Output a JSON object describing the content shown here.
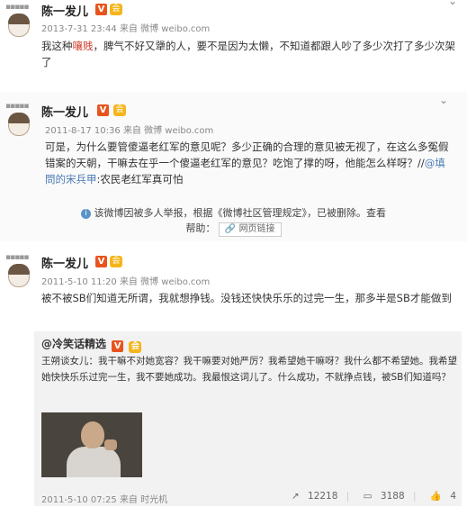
{
  "posts": [
    {
      "author": "陈一发儿",
      "time": "2013-7-31 23:44",
      "via_prefix": "来自",
      "source": "微博 weibo.com",
      "text_before": "我这种",
      "text_highlight": "嚷贱",
      "text_after": "，脾气不好又犟的人，要不是因为太懒，不知道都跟人吵了多少次打了多少次架了"
    },
    {
      "author": "陈一发儿",
      "time": "2011-8-17 10:36",
      "via_prefix": "来自",
      "source": "微博 weibo.com",
      "text_before": "可是，为什么要管傻逼老红军的意见呢？多少正确的合理的意见被无视了，在这么多冤假错案的天朝，干嘛去在乎一个傻逼老红军的意见？吃饱了撑的呀，他能怎么样呀？//",
      "mention": "@填問的宋兵甲",
      "text_after": ":农民老红军真可怕",
      "notice_line1": "该微博因被多人举报，根据《微博社区管理规定》，已被删除。查看",
      "notice_help": "帮助：",
      "notice_button": "网页链接"
    },
    {
      "author": "陈一发儿",
      "time": "2011-5-10 11:20",
      "via_prefix": "来自",
      "source": "微博 weibo.com",
      "text": "被不被SB们知道无所谓，我就想挣钱。没钱还快快乐乐的过完一生，那多半是SB才能做到",
      "repost": {
        "author": "@冷笑话精选",
        "text": "王朔谈女儿：我干嘛不对她宽容？我干嘛要对她严厉？我希望她干嘛呀？我什么都不希望她。我希望她快快乐乐过完一生，我不要她成功。我最恨这词儿了。什么成功，不就挣点钱，被SB们知道吗？",
        "time": "2011-5-10 07:25",
        "via_prefix": "来自",
        "source": "时光机",
        "reposts": "12218",
        "comments": "3188",
        "likes": "4"
      }
    }
  ],
  "badges": {
    "verified": "V",
    "member": "会"
  },
  "icons": [
    "avatar-dots-icon",
    "chevron-down-icon",
    "info-icon",
    "link-icon",
    "repost-icon",
    "comment-icon",
    "like-icon"
  ],
  "colors": {
    "highlight": "#d23b2a",
    "verified": "#e8541e",
    "link": "#4a7ab5"
  }
}
